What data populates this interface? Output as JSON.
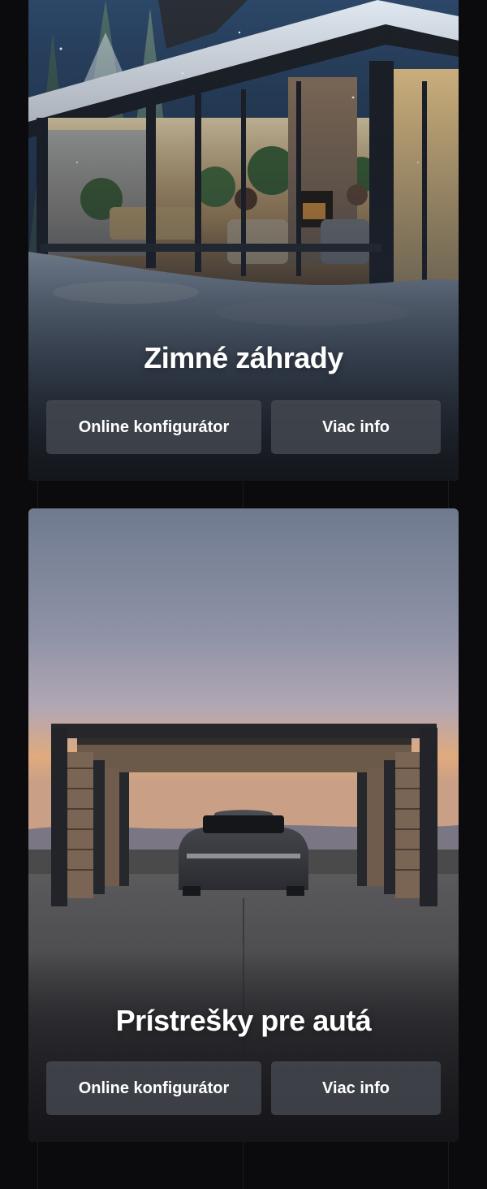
{
  "cards": [
    {
      "title": "Zimné záhrady",
      "buttons": {
        "configurator": "Online konfigurátor",
        "info": "Viac info"
      }
    },
    {
      "title": "Prístrešky pre autá",
      "buttons": {
        "configurator": "Online konfigurátor",
        "info": "Viac info"
      }
    }
  ],
  "colors": {
    "background": "#0b0a0c",
    "button": "#464a52"
  }
}
